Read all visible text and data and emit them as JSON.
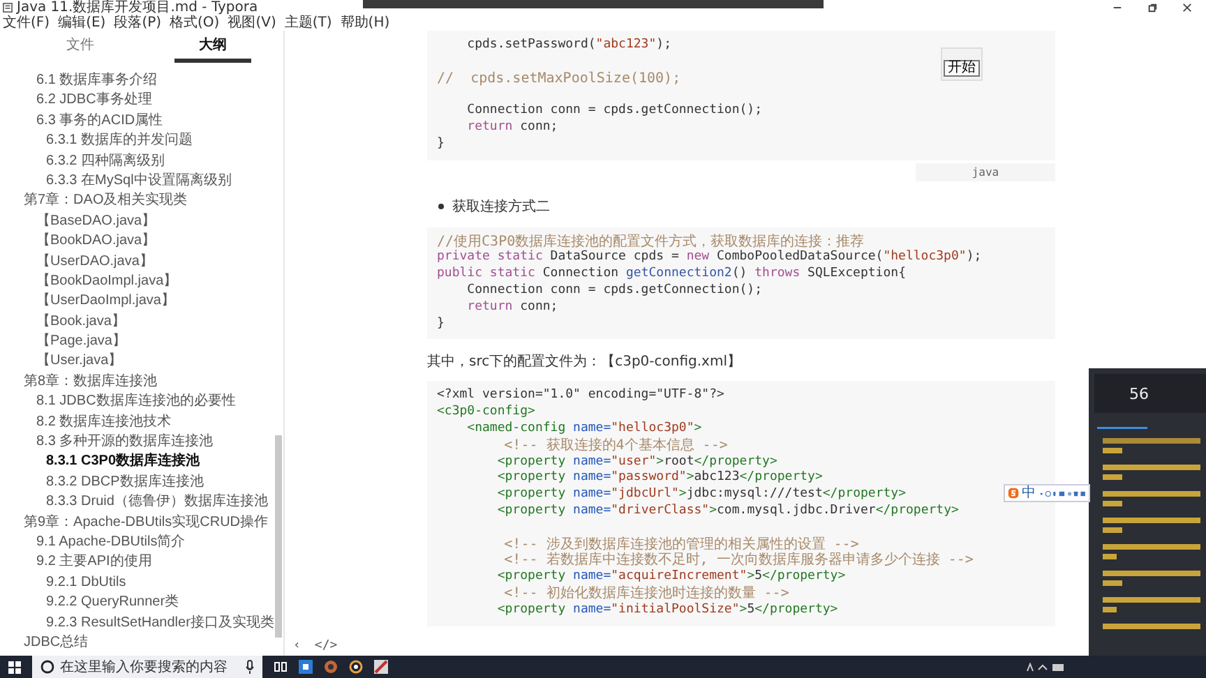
{
  "window": {
    "title": "Java 11.数据库开发项目.md - Typora"
  },
  "menu": [
    "文件(F)",
    "编辑(E)",
    "段落(P)",
    "格式(O)",
    "视图(V)",
    "主题(T)",
    "帮助(H)"
  ],
  "sidebar": {
    "tabs": [
      {
        "label": "文件",
        "selected": false
      },
      {
        "label": "大纲",
        "selected": true
      }
    ],
    "outline": [
      {
        "children": [
          {
            "label": "6.1 数据库事务介绍",
            "selected": false
          },
          {
            "label": "6.2 JDBC事务处理",
            "selected": false
          },
          {
            "label": "6.3 事务的ACID属性",
            "selected": false,
            "children": [
              {
                "label": "6.3.1 数据库的并发问题",
                "selected": false
              },
              {
                "label": "6.3.2 四种隔离级别",
                "selected": false
              },
              {
                "label": "6.3.3 在MySql中设置隔离级别",
                "selected": false
              }
            ]
          }
        ]
      },
      {
        "label": "第7章：DAO及相关实现类",
        "selected": false,
        "children": [
          {
            "label": "【BaseDAO.java】",
            "selected": false
          },
          {
            "label": "【BookDAO.java】",
            "selected": false
          },
          {
            "label": "【UserDAO.java】",
            "selected": false
          },
          {
            "label": "【BookDaoImpl.java】",
            "selected": false
          },
          {
            "label": "【UserDaoImpl.java】",
            "selected": false
          },
          {
            "label": "【Book.java】",
            "selected": false
          },
          {
            "label": "【Page.java】",
            "selected": false
          },
          {
            "label": "【User.java】",
            "selected": false
          }
        ]
      },
      {
        "label": "第8章：数据库连接池",
        "selected": false,
        "children": [
          {
            "label": "8.1 JDBC数据库连接池的必要性",
            "selected": false
          },
          {
            "label": "8.2 数据库连接池技术",
            "selected": false
          },
          {
            "label": "8.3 多种开源的数据库连接池",
            "selected": false,
            "children": [
              {
                "label": "8.3.1 C3P0数据库连接池",
                "selected": true
              },
              {
                "label": "8.3.2 DBCP数据库连接池",
                "selected": false
              },
              {
                "label": "8.3.3 Druid（德鲁伊）数据库连接池",
                "selected": false
              }
            ]
          }
        ]
      },
      {
        "label": "第9章：Apache-DBUtils实现CRUD操作",
        "selected": false,
        "children": [
          {
            "label": "9.1 Apache-DBUtils简介",
            "selected": false
          },
          {
            "label": "9.2 主要API的使用",
            "selected": false,
            "children": [
              {
                "label": "9.2.1 DbUtils",
                "selected": false
              },
              {
                "label": "9.2.2 QueryRunner类",
                "selected": false
              },
              {
                "label": "9.2.3 ResultSetHandler接口及实现类",
                "selected": false
              }
            ]
          }
        ]
      },
      {
        "label": "JDBC总结",
        "selected": false
      }
    ]
  },
  "content": [
    {
      "kind": "code",
      "language": "java",
      "lines": [
        {
          "tokens": [
            {
              "t": "    cpds.setPassword(",
              "kind": "plain"
            },
            {
              "t": "\"abc123\"",
              "kind": "string"
            },
            {
              "t": ");",
              "kind": "plain"
            }
          ]
        },
        {
          "blank_before": true,
          "tokens": [
            {
              "t": "//  cpds.setMaxPoolSize(100);",
              "kind": "comment"
            }
          ]
        },
        {
          "blank_before": true,
          "tokens": [
            {
              "t": "    Connection conn = cpds.getConnection();",
              "kind": "plain"
            }
          ]
        },
        {
          "tokens": [
            {
              "t": "    return",
              "kind": "keyword"
            },
            {
              "t": " conn;",
              "kind": "plain"
            }
          ]
        },
        {
          "tokens": [
            {
              "t": "}",
              "kind": "plain"
            }
          ]
        }
      ]
    },
    {
      "kind": "bullet",
      "text": "获取连接方式二"
    },
    {
      "kind": "code",
      "lines": [
        {
          "tokens": [
            {
              "t": "//使用C3P0数据库连接池的配置文件方式，获取数据库的连接：推荐",
              "kind": "comment"
            }
          ]
        },
        {
          "tokens": [
            {
              "t": "private static",
              "kind": "keyword"
            },
            {
              "t": " DataSource cpds = ",
              "kind": "plain"
            },
            {
              "t": "new",
              "kind": "keyword"
            },
            {
              "t": " ComboPooledDataSource(",
              "kind": "plain"
            },
            {
              "t": "\"helloc3p0\"",
              "kind": "string"
            },
            {
              "t": ");",
              "kind": "plain"
            }
          ]
        },
        {
          "tokens": [
            {
              "t": "public static",
              "kind": "keyword"
            },
            {
              "t": " Connection ",
              "kind": "plain"
            },
            {
              "t": "getConnection2",
              "kind": "function"
            },
            {
              "t": "() ",
              "kind": "plain"
            },
            {
              "t": "throws",
              "kind": "keyword"
            },
            {
              "t": " SQLException{",
              "kind": "plain"
            }
          ]
        },
        {
          "tokens": [
            {
              "t": "    Connection conn = cpds.getConnection();",
              "kind": "plain"
            }
          ]
        },
        {
          "tokens": [
            {
              "t": "    return",
              "kind": "keyword"
            },
            {
              "t": " conn;",
              "kind": "plain"
            }
          ]
        },
        {
          "tokens": [
            {
              "t": "}",
              "kind": "plain"
            }
          ]
        }
      ]
    },
    {
      "kind": "paragraph",
      "text": "其中，src下的配置文件为：【c3p0-config.xml】"
    },
    {
      "kind": "code",
      "lines": [
        {
          "tokens": [
            {
              "t": "<?xml version=\"1.0\" encoding=\"UTF-8\"?>",
              "kind": "plain"
            }
          ]
        },
        {
          "tokens": [
            {
              "t": "<c3p0-config>",
              "kind": "tag"
            }
          ]
        },
        {
          "tokens": [
            {
              "t": "    <named-config",
              "kind": "tag"
            },
            {
              "t": " name=",
              "kind": "attr"
            },
            {
              "t": "\"helloc3p0\"",
              "kind": "string"
            },
            {
              "t": ">",
              "kind": "tag"
            }
          ]
        },
        {
          "tokens": [
            {
              "t": "        <!-- 获取连接的4个基本信息 -->",
              "kind": "comment"
            }
          ]
        },
        {
          "tokens": [
            {
              "t": "        <property",
              "kind": "tag"
            },
            {
              "t": " name=",
              "kind": "attr"
            },
            {
              "t": "\"user\"",
              "kind": "string"
            },
            {
              "t": ">",
              "kind": "tag"
            },
            {
              "t": "root",
              "kind": "plain"
            },
            {
              "t": "</property>",
              "kind": "tag"
            }
          ]
        },
        {
          "tokens": [
            {
              "t": "        <property",
              "kind": "tag"
            },
            {
              "t": " name=",
              "kind": "attr"
            },
            {
              "t": "\"password\"",
              "kind": "string"
            },
            {
              "t": ">",
              "kind": "tag"
            },
            {
              "t": "abc123",
              "kind": "plain"
            },
            {
              "t": "</property>",
              "kind": "tag"
            }
          ]
        },
        {
          "tokens": [
            {
              "t": "        <property",
              "kind": "tag"
            },
            {
              "t": " name=",
              "kind": "attr"
            },
            {
              "t": "\"jdbcUrl\"",
              "kind": "string"
            },
            {
              "t": ">",
              "kind": "tag"
            },
            {
              "t": "jdbc:mysql:///test",
              "kind": "plain"
            },
            {
              "t": "</property>",
              "kind": "tag"
            }
          ]
        },
        {
          "tokens": [
            {
              "t": "        <property",
              "kind": "tag"
            },
            {
              "t": " name=",
              "kind": "attr"
            },
            {
              "t": "\"driverClass\"",
              "kind": "string"
            },
            {
              "t": ">",
              "kind": "tag"
            },
            {
              "t": "com.mysql.jdbc.Driver",
              "kind": "plain"
            },
            {
              "t": "</property>",
              "kind": "tag"
            }
          ]
        },
        {
          "blank_before": true,
          "tokens": [
            {
              "t": "        <!-- 涉及到数据库连接池的管理的相关属性的设置 -->",
              "kind": "comment"
            }
          ]
        },
        {
          "tokens": [
            {
              "t": "        <!-- 若数据库中连接数不足时, 一次向数据库服务器申请多少个连接 -->",
              "kind": "comment"
            }
          ]
        },
        {
          "tokens": [
            {
              "t": "        <property",
              "kind": "tag"
            },
            {
              "t": " name=",
              "kind": "attr"
            },
            {
              "t": "\"acquireIncrement\"",
              "kind": "string"
            },
            {
              "t": ">",
              "kind": "tag"
            },
            {
              "t": "5",
              "kind": "plain"
            },
            {
              "t": "</property>",
              "kind": "tag"
            }
          ]
        },
        {
          "tokens": [
            {
              "t": "        <!-- 初始化数据库连接池时连接的数量 -->",
              "kind": "comment"
            }
          ]
        },
        {
          "tokens": [
            {
              "t": "        <property",
              "kind": "tag"
            },
            {
              "t": " name=",
              "kind": "attr"
            },
            {
              "t": "\"initialPoolSize\"",
              "kind": "string"
            },
            {
              "t": ">",
              "kind": "tag"
            },
            {
              "t": "5",
              "kind": "plain"
            },
            {
              "t": "</property>",
              "kind": "tag"
            }
          ]
        }
      ]
    }
  ],
  "footer_buttons": [
    "‹",
    "</>"
  ],
  "popup": {
    "button": "开始"
  },
  "ime_bar": {
    "mode": "中"
  },
  "live_panel": {
    "count": "56"
  },
  "taskbar": {
    "search_placeholder": "在这里输入你要搜索的内容"
  }
}
